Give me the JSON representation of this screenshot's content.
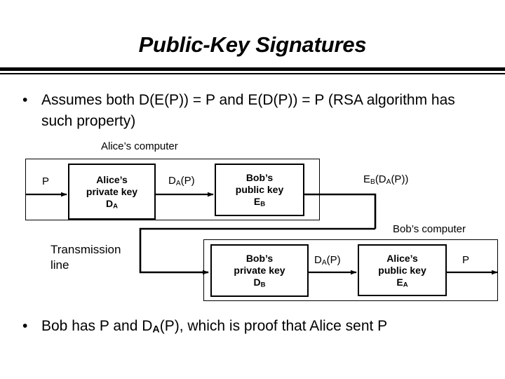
{
  "slide": {
    "title": "Public-Key Signatures"
  },
  "bullets": [
    {
      "marker": "•",
      "text": "Assumes both D(E(P)) = P and E(D(P)) = P (RSA algorithm has such property)"
    },
    {
      "marker": "•",
      "text": "Bob has P and D",
      "sub": "A",
      "text_tail": "(P), which is proof that Alice sent P"
    }
  ],
  "diagram": {
    "alice_computer_label": "Alice’s computer",
    "bob_computer_label": "Bob’s computer",
    "transmission_label_line1": "Transmission",
    "transmission_label_line2": "line",
    "boxes": {
      "alice_private": {
        "line1": "Alice’s",
        "line2": "private key",
        "line3_base": "D",
        "line3_sub": "A"
      },
      "bob_public": {
        "line1": "Bob’s",
        "line2": "public key",
        "line3_base": "E",
        "line3_sub": "B"
      },
      "bob_private": {
        "line1": "Bob’s",
        "line2": "private key",
        "line3_base": "D",
        "line3_sub": "B"
      },
      "alice_public": {
        "line1": "Alice’s",
        "line2": "public key",
        "line3_base": "E",
        "line3_sub": "A"
      }
    },
    "labels": {
      "p_in": "P",
      "da_p_top": {
        "base": "D",
        "sub": "A",
        "tail": "(P)"
      },
      "eb_da_p": {
        "base1": "E",
        "sub1": "B",
        "mid": "(D",
        "sub2": "A",
        "tail": "(P))"
      },
      "da_p_bottom": {
        "base": "D",
        "sub": "A",
        "tail": "(P)"
      },
      "p_out": "P"
    }
  },
  "colors": {
    "ink": "#000000",
    "background": "#ffffff"
  }
}
